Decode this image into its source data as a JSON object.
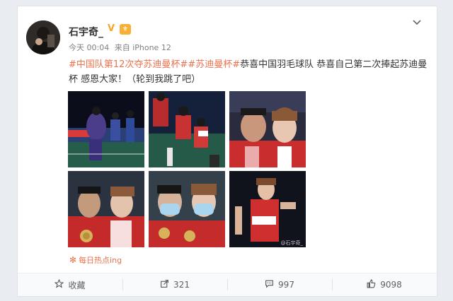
{
  "post": {
    "username": "石宇奇_",
    "verified_badge": "V",
    "vip_badge": "⚜",
    "time": "今天 00:04",
    "source": "来自 iPhone 12",
    "hashtags": [
      "#中国队第12次夺苏迪曼杯#",
      "#苏迪曼杯#"
    ],
    "body_text": "恭喜中国羽毛球队 恭喜自己第二次捧起苏迪曼杯 感恩大家！（轮到我跳了吧）",
    "topic_source": "每日热点ing"
  },
  "actions": {
    "favorite_label": "收藏",
    "repost_count": "321",
    "comment_count": "997",
    "like_count": "9098"
  },
  "images": [
    {
      "name": "team-celebration-photo",
      "desc": "team celebration"
    },
    {
      "name": "player-jump-photo",
      "desc": "player jumping"
    },
    {
      "name": "selfie-coach-photo",
      "desc": "selfie with coach"
    },
    {
      "name": "selfie-medals-photo",
      "desc": "selfie with medals"
    },
    {
      "name": "masked-selfie-photo",
      "desc": "masked selfie"
    },
    {
      "name": "player-cheer-photo",
      "desc": "player cheering"
    }
  ],
  "image_watermark": "@石宇奇_",
  "colors": {
    "hashtag": "#eb7350",
    "badge": "#f7b035",
    "page_bg": "#e9ecf1"
  }
}
